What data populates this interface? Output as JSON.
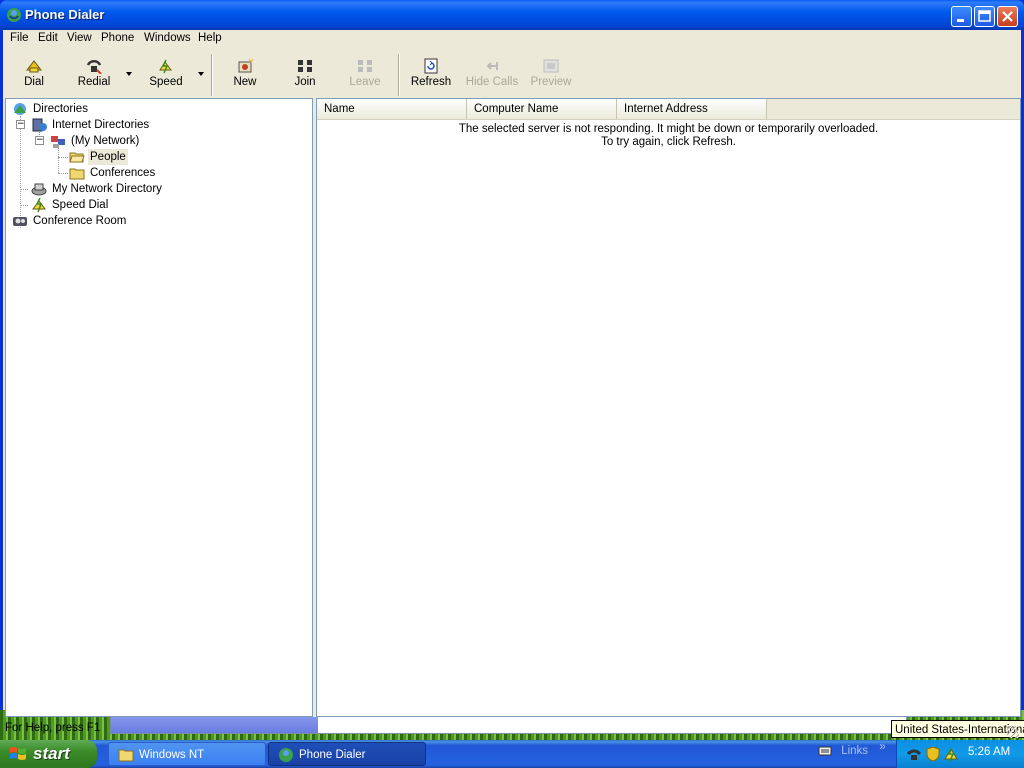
{
  "window": {
    "title": "Phone Dialer"
  },
  "menu": [
    "File",
    "Edit",
    "View",
    "Phone",
    "Windows",
    "Help"
  ],
  "toolbar": {
    "dial": "Dial",
    "redial": "Redial",
    "speed": "Speed",
    "new": "New",
    "join": "Join",
    "leave": "Leave",
    "refresh": "Refresh",
    "hide_calls": "Hide Calls",
    "preview": "Preview"
  },
  "tree": {
    "directories": "Directories",
    "internet_directories": "Internet Directories",
    "my_network": "(My Network)",
    "people": "People",
    "conferences": "Conferences",
    "my_network_directory": "My Network Directory",
    "speed_dial": "Speed Dial",
    "conference_room": "Conference Room",
    "selected": "People"
  },
  "list": {
    "columns": [
      "Name",
      "Computer Name",
      "Internet Address"
    ],
    "message_line1": "The selected server is not responding. It might be down or temporarily overloaded.",
    "message_line2": "To try again, click Refresh."
  },
  "status": {
    "text": "For Help, press F1"
  },
  "taskbar": {
    "start": "start",
    "tasks": [
      "Windows NT",
      "Phone Dialer"
    ],
    "active_task": "Phone Dialer",
    "links": "Links",
    "links_chevron": "»",
    "clock": "5:26 AM"
  },
  "tooltip": "United States-International",
  "progress": {
    "fraction": 0.26
  },
  "colors": {
    "titlebar": "#0058ee",
    "taskbar": "#245edb",
    "start": "#3c8c2a",
    "tray": "#119ae8"
  }
}
